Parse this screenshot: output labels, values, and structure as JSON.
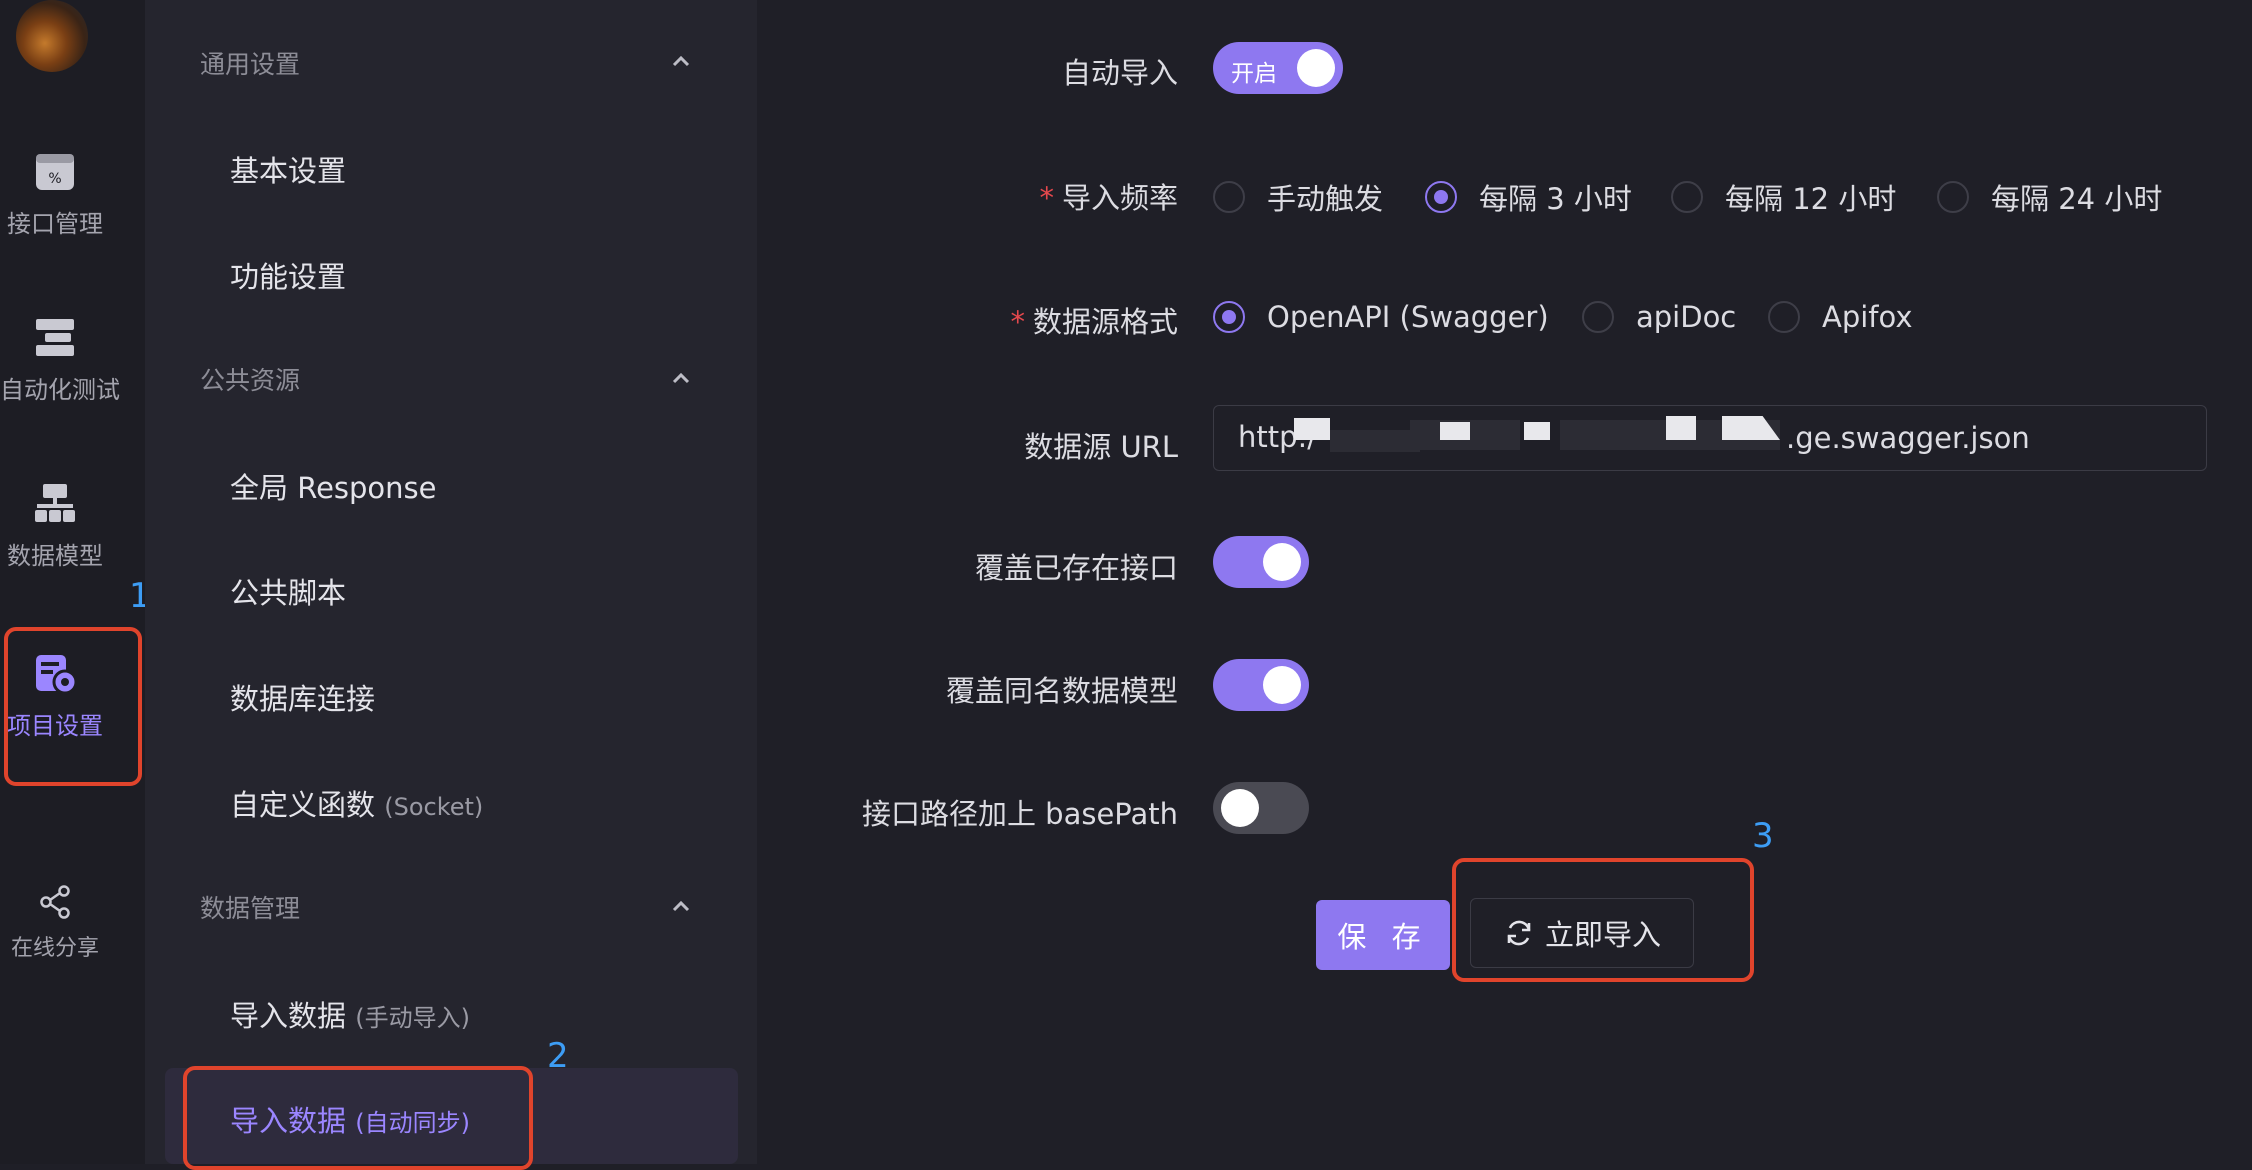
{
  "rail": {
    "items": [
      {
        "label": "接口管理",
        "icon": "api-management-icon"
      },
      {
        "label": "自动化测试",
        "icon": "automation-test-icon"
      },
      {
        "label": "数据模型",
        "icon": "data-model-icon"
      },
      {
        "label": "项目设置",
        "icon": "project-settings-icon",
        "active": true
      },
      {
        "label": "在线分享",
        "icon": "share-icon"
      }
    ]
  },
  "sidebar": {
    "sections": [
      {
        "title": "通用设置",
        "items": [
          "基本设置",
          "功能设置"
        ]
      },
      {
        "title": "公共资源",
        "items": [
          "全局 Response",
          "公共脚本",
          "数据库连接"
        ]
      },
      {
        "title": "数据管理",
        "items": []
      }
    ],
    "custom_func": {
      "label": "自定义函数",
      "sub": "(Socket)"
    },
    "import_manual": {
      "label": "导入数据",
      "sub": "(手动导入)"
    },
    "import_auto": {
      "label": "导入数据",
      "sub": "(自动同步)"
    }
  },
  "form": {
    "auto_import": {
      "label": "自动导入",
      "toggle_text": "开启",
      "on": true
    },
    "frequency": {
      "label": "导入频率",
      "required": true,
      "options": [
        "手动触发",
        "每隔 3 小时",
        "每隔 12 小时",
        "每隔 24 小时"
      ],
      "selected": "每隔 3 小时"
    },
    "format": {
      "label": "数据源格式",
      "required": true,
      "options": [
        "OpenAPI (Swagger)",
        "apiDoc",
        "Apifox"
      ],
      "selected": "OpenAPI (Swagger)"
    },
    "url": {
      "label": "数据源 URL",
      "value_prefix": "http:/",
      "value_suffix": ".ge.swagger.json"
    },
    "override_api": {
      "label": "覆盖已存在接口",
      "on": true
    },
    "override_model": {
      "label": "覆盖同名数据模型",
      "on": true
    },
    "base_path": {
      "label": "接口路径加上 basePath",
      "on": false
    },
    "save_label": "保 存",
    "import_now_label": "立即导入"
  },
  "annotations": [
    "1",
    "2",
    "3"
  ],
  "colors": {
    "accent": "#8e78f0",
    "annotation_box": "#e0442c",
    "annotation_num": "#3d9df5"
  }
}
